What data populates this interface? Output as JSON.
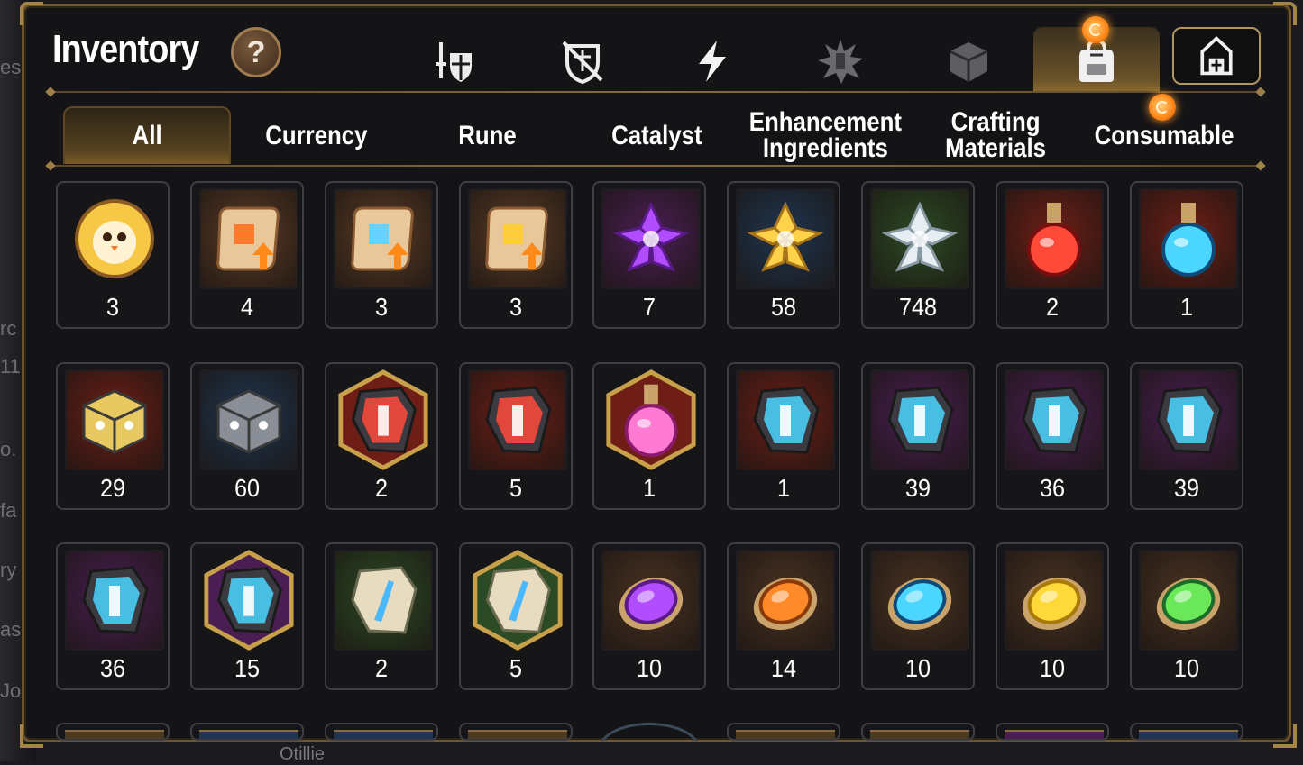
{
  "title": "Inventory",
  "help_label": "?",
  "category_tabs": [
    {
      "icon": "sword-shield-icon",
      "active": false
    },
    {
      "icon": "broken-shield-icon",
      "active": false
    },
    {
      "icon": "lightning-icon",
      "active": false
    },
    {
      "icon": "burst-emblem-icon",
      "active": false
    },
    {
      "icon": "gem-cube-icon",
      "active": false
    },
    {
      "icon": "backpack-icon",
      "active": true,
      "notify": true
    }
  ],
  "home_button_icon": "castle-icon",
  "sub_tabs": [
    {
      "label": "All",
      "active": true
    },
    {
      "label": "Currency"
    },
    {
      "label": "Rune"
    },
    {
      "label": "Catalyst"
    },
    {
      "label": "Enhancement\nIngredients"
    },
    {
      "label": "Crafting\nMaterials"
    },
    {
      "label": "Consumable",
      "notify": true
    }
  ],
  "background_text": [
    "es",
    "rc",
    "11",
    "o.",
    "fa",
    "ry",
    "as",
    "Jo"
  ],
  "background_bottom_text": "Otillie",
  "items": [
    [
      {
        "icon": "chick-medal-icon",
        "count": "3",
        "bg": "#7a5a3a"
      },
      {
        "icon": "scroll-orange-icon",
        "count": "4",
        "bg": "#5a3a24"
      },
      {
        "icon": "scroll-rainbow-icon",
        "count": "3",
        "bg": "#5a3a24"
      },
      {
        "icon": "scroll-gold-icon",
        "count": "3",
        "bg": "#5a3a24"
      },
      {
        "icon": "purple-crystal-flower-icon",
        "count": "7",
        "bg": "#4a1e52"
      },
      {
        "icon": "gold-crystal-flower-icon",
        "count": "58",
        "bg": "#1f3550"
      },
      {
        "icon": "silver-crystal-flower-icon",
        "count": "748",
        "bg": "#2c4a24"
      },
      {
        "icon": "red-potion-icon",
        "count": "2",
        "bg": "#6e1e16"
      },
      {
        "icon": "blue-star-potion-icon",
        "count": "1",
        "bg": "#6e1e16"
      }
    ],
    [
      {
        "icon": "gold-chest-icon",
        "count": "29",
        "bg": "#6e1e16"
      },
      {
        "icon": "silver-chest-icon",
        "count": "60",
        "bg": "#1f3550"
      },
      {
        "icon": "red-rune-star-icon",
        "count": "2",
        "bg": "#6e1e16"
      },
      {
        "icon": "red-rune-hammer-icon",
        "count": "5",
        "bg": "#6e1e16"
      },
      {
        "icon": "pink-potion-icon",
        "count": "1",
        "bg": "#6e1e16"
      },
      {
        "icon": "blue-rune-hammer-icon",
        "count": "1",
        "bg": "#6e1e16"
      },
      {
        "icon": "rune-sword-icon",
        "count": "39",
        "bg": "#4a1e52"
      },
      {
        "icon": "rune-spiral-icon",
        "count": "36",
        "bg": "#4a1e52"
      },
      {
        "icon": "rune-armor-icon",
        "count": "39",
        "bg": "#4a1e52"
      }
    ],
    [
      {
        "icon": "rune-boot-icon",
        "count": "36",
        "bg": "#4a1e52"
      },
      {
        "icon": "rune-star-purple-icon",
        "count": "15",
        "bg": "#4a1e52"
      },
      {
        "icon": "stone-sword-icon",
        "count": "2",
        "bg": "#2c4a24"
      },
      {
        "icon": "stone-star-icon",
        "count": "5",
        "bg": "#2c4a24"
      },
      {
        "icon": "purple-orb-icon",
        "count": "10",
        "bg": "#4a3222"
      },
      {
        "icon": "orange-orb-icon",
        "count": "14",
        "bg": "#4a3222"
      },
      {
        "icon": "blue-orb-icon",
        "count": "10",
        "bg": "#4a3222"
      },
      {
        "icon": "yellow-orb-icon",
        "count": "10",
        "bg": "#4a3222"
      },
      {
        "icon": "green-orb-icon",
        "count": "10",
        "bg": "#4a3222"
      }
    ]
  ]
}
